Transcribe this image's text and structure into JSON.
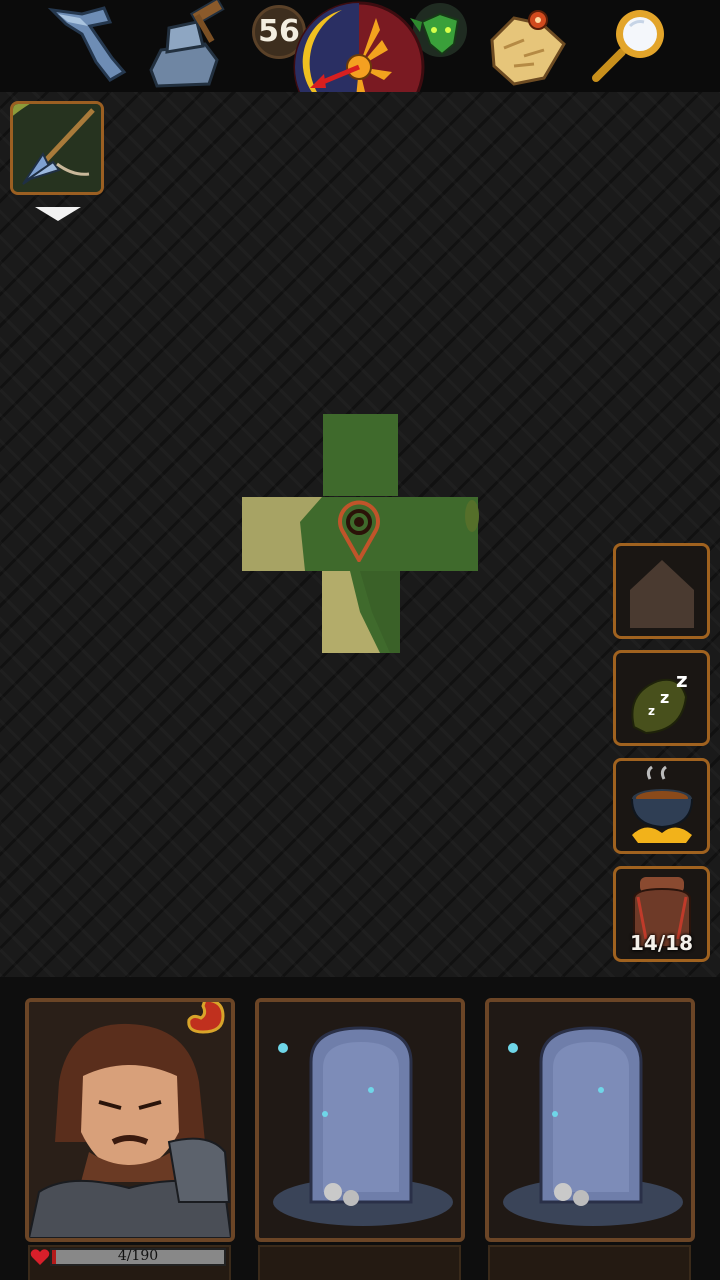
{
  "top_bar": {
    "day_count": "56",
    "tools": [
      {
        "name": "crafting-pickaxe-icon"
      },
      {
        "name": "anvil-hammer-icon"
      },
      {
        "name": "goblin-head-icon"
      },
      {
        "name": "treasure-map-icon"
      },
      {
        "name": "magnifying-glass-icon"
      }
    ],
    "compass": "day-night-compass-icon"
  },
  "active_quest": {
    "icon": "arrow-weapon-icon"
  },
  "side_actions": [
    {
      "name": "build-house-button",
      "icon": "house-icon"
    },
    {
      "name": "sleep-button",
      "icon": "sleep-zzz-icon"
    },
    {
      "name": "cook-button",
      "icon": "cooking-pot-icon"
    },
    {
      "name": "backpack-button",
      "icon": "backpack-icon",
      "count": "14/18"
    }
  ],
  "party": {
    "hero": {
      "hp_text": "4/190",
      "hp_fraction": 0.0211,
      "hunger_icon": "stomach-icon"
    },
    "empty_slots": 2
  },
  "colors": {
    "grass": "#3f6a2c",
    "dirt": "#a7a364",
    "frame": "#a0621f",
    "marker": "#c0542a"
  }
}
